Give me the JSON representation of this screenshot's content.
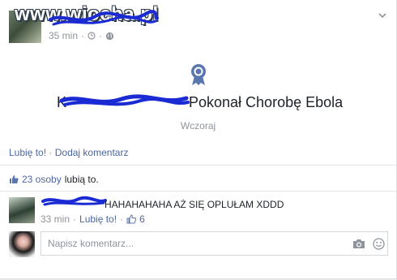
{
  "post": {
    "watermark": "www.wiocha.pl",
    "time": "35 min",
    "privacy_icon": "globe-icon",
    "clock_icon": "clock-icon"
  },
  "event": {
    "title": "Pokonał Chorobę Ebola",
    "date": "Wczoraj",
    "icon": "award-ribbon-icon"
  },
  "actions": {
    "like": "Lubię to!",
    "separator": "·",
    "comment": "Dodaj komentarz"
  },
  "likes": {
    "count_text": "23 osoby",
    "suffix": "lubią to."
  },
  "comment": {
    "text": "HAHAHAHAHA AŻ SIĘ OPLUŁAM XDDD",
    "time": "33 min",
    "like": "Lubię to!",
    "like_count": "6"
  },
  "composer": {
    "placeholder": "Napisz komentarz..."
  },
  "colors": {
    "link": "#4b67a1",
    "muted": "#90949c",
    "scribble": "#1a2bd4"
  }
}
